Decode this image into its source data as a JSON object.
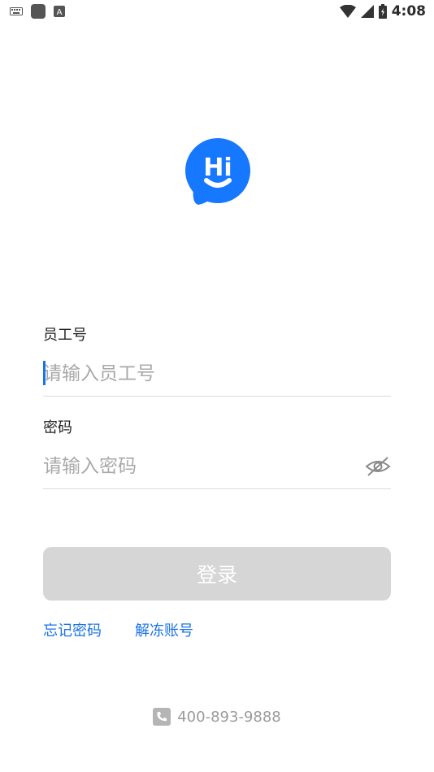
{
  "status_bar": {
    "time": "4:08",
    "left_icons": [
      "keyboard-icon",
      "app-icon",
      "a-icon"
    ],
    "right_icons": [
      "wifi-icon",
      "signal-icon",
      "battery-icon"
    ]
  },
  "logo": {
    "text": "Hi",
    "color": "#1677ff"
  },
  "form": {
    "employee_label": "员工号",
    "employee_placeholder": "请输入员工号",
    "password_label": "密码",
    "password_placeholder": "请输入密码"
  },
  "login_button": "登录",
  "links": {
    "forgot_password": "忘记密码",
    "unfreeze_account": "解冻账号"
  },
  "footer": {
    "phone": "400-893-9888"
  },
  "colors": {
    "accent": "#1a73e8",
    "disabled_button": "#d6d6d6"
  }
}
